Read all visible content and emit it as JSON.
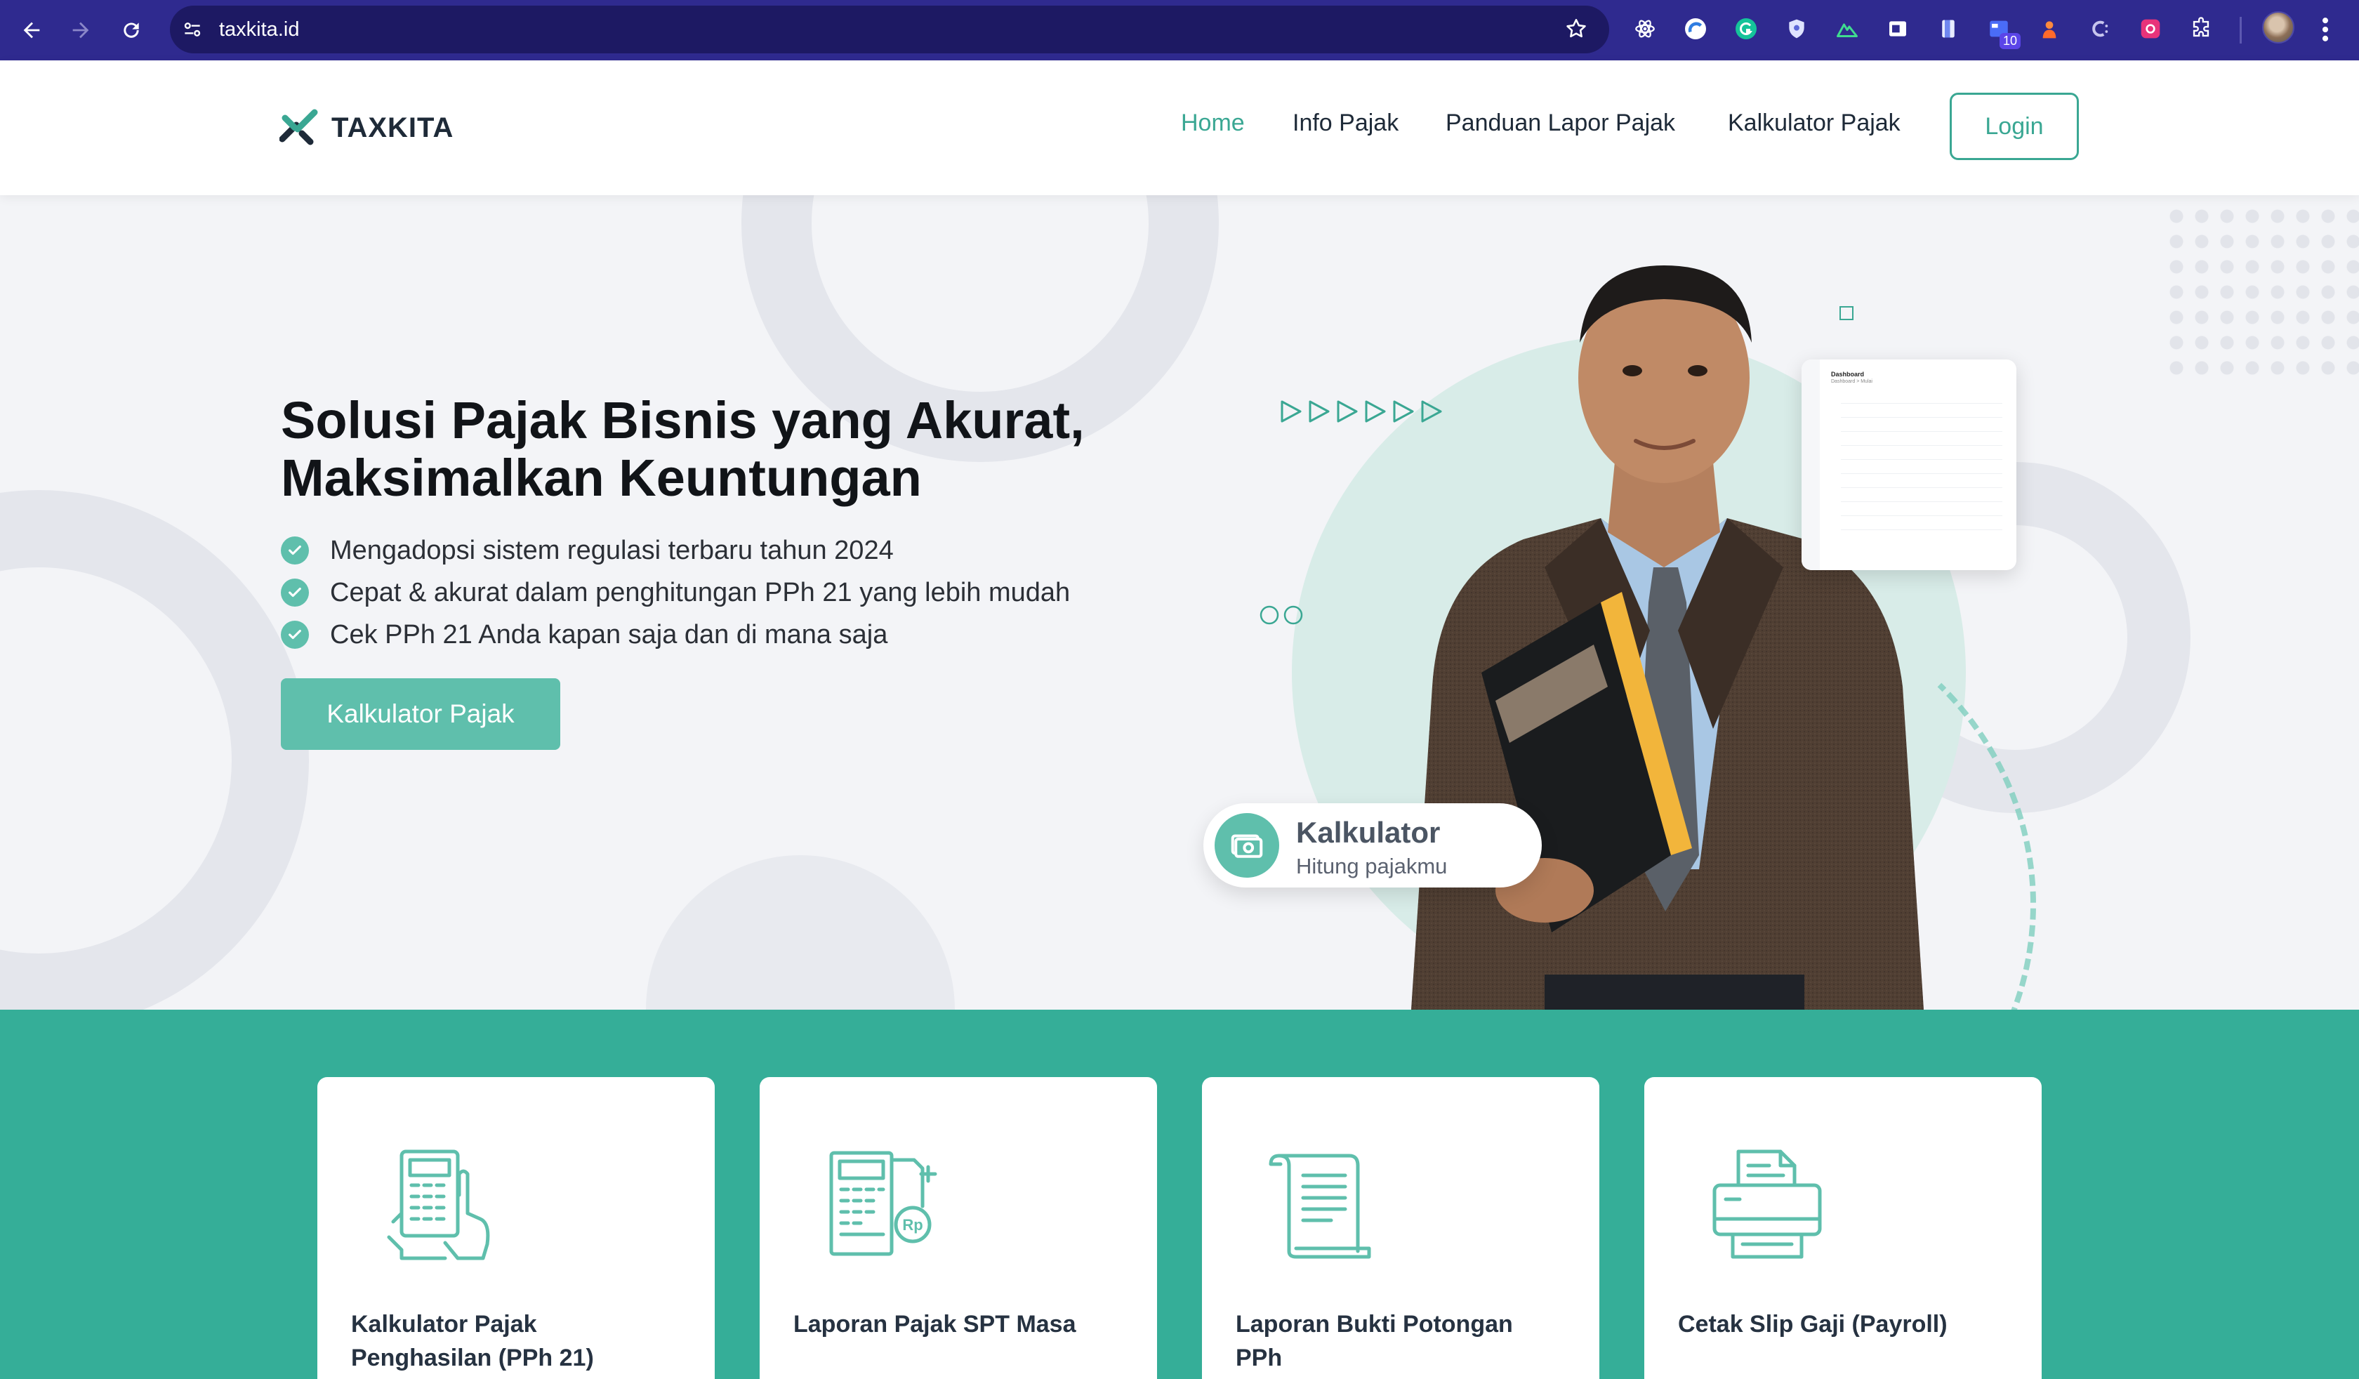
{
  "browser": {
    "url": "taxkita.id",
    "extension_badge": "10",
    "icons": [
      "back-icon",
      "forward-icon",
      "reload-icon",
      "site-info-icon",
      "bookmark-star-icon",
      "extensions-puzzle-icon",
      "menu-kebab-icon"
    ]
  },
  "header": {
    "brand": "TAXKITA",
    "nav": {
      "home": "Home",
      "info": "Info Pajak",
      "panduan": "Panduan Lapor Pajak",
      "kalkulator": "Kalkulator Pajak",
      "login": "Login"
    }
  },
  "hero": {
    "title_line1": "Solusi Pajak Bisnis yang Akurat,",
    "title_line2": "Maksimalkan Keuntungan",
    "bullets": [
      "Mengadopsi sistem regulasi terbaru tahun 2024",
      "Cepat & akurat dalam penghitungan PPh 21 yang lebih mudah",
      "Cek PPh 21 Anda kapan saja dan di mana saja"
    ],
    "cta": "Kalkulator Pajak",
    "widget": {
      "title": "Kalkulator",
      "subtitle": "Hitung pajakmu"
    },
    "dashboard_preview": {
      "title": "Dashboard",
      "subtitle": "Dashboard > Mulai"
    }
  },
  "services": [
    {
      "title": "Kalkulator Pajak Penghasilan (PPh 21)",
      "icon": "calculator-hand-icon"
    },
    {
      "title": "Laporan Pajak SPT Masa",
      "icon": "tax-report-rp-icon"
    },
    {
      "title": "Laporan Bukti Potongan PPh",
      "icon": "scroll-document-icon"
    },
    {
      "title": "Cetak Slip Gaji (Payroll)",
      "icon": "printer-icon"
    }
  ],
  "colors": {
    "brand_teal": "#3aa793",
    "light_teal": "#5fbfac",
    "services_bg": "#35ae98",
    "chrome_bg": "#2f2a8f"
  }
}
